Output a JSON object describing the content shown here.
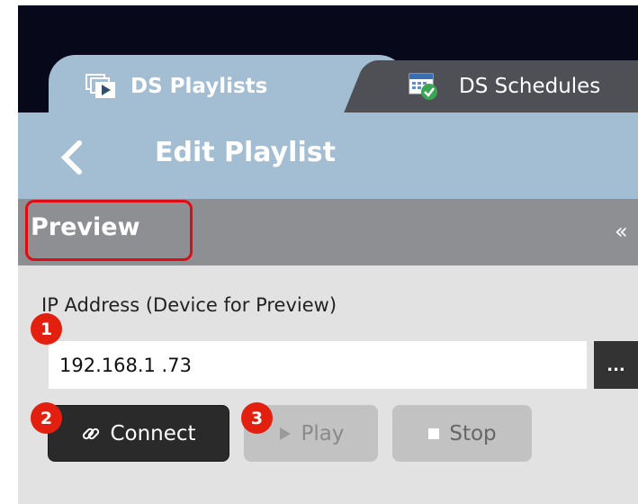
{
  "tabs": [
    {
      "label": "DS Playlists",
      "active": true,
      "icon": "playlist-icon"
    },
    {
      "label": "DS Schedules",
      "active": false,
      "icon": "calendar-check-icon"
    }
  ],
  "header": {
    "title": "Edit Playlist",
    "back_icon": "chevron-left-icon"
  },
  "preview": {
    "section_title": "Preview",
    "collapse_icon": "«",
    "ip_label": "IP Address (Device for Preview)",
    "ip_value": "192.168.1 .73",
    "more_label": "...",
    "connect_label": "Connect",
    "play_label": "Play",
    "stop_label": "Stop"
  },
  "annotations": {
    "badge1": "1",
    "badge2": "2",
    "badge3": "3"
  },
  "colors": {
    "tab_active": "#a3bdd3",
    "tab_inactive": "#4e5056",
    "section_bar": "#8d8f93",
    "panel": "#e2e2e2",
    "badge": "#e3200f",
    "highlight": "#e00c14"
  }
}
